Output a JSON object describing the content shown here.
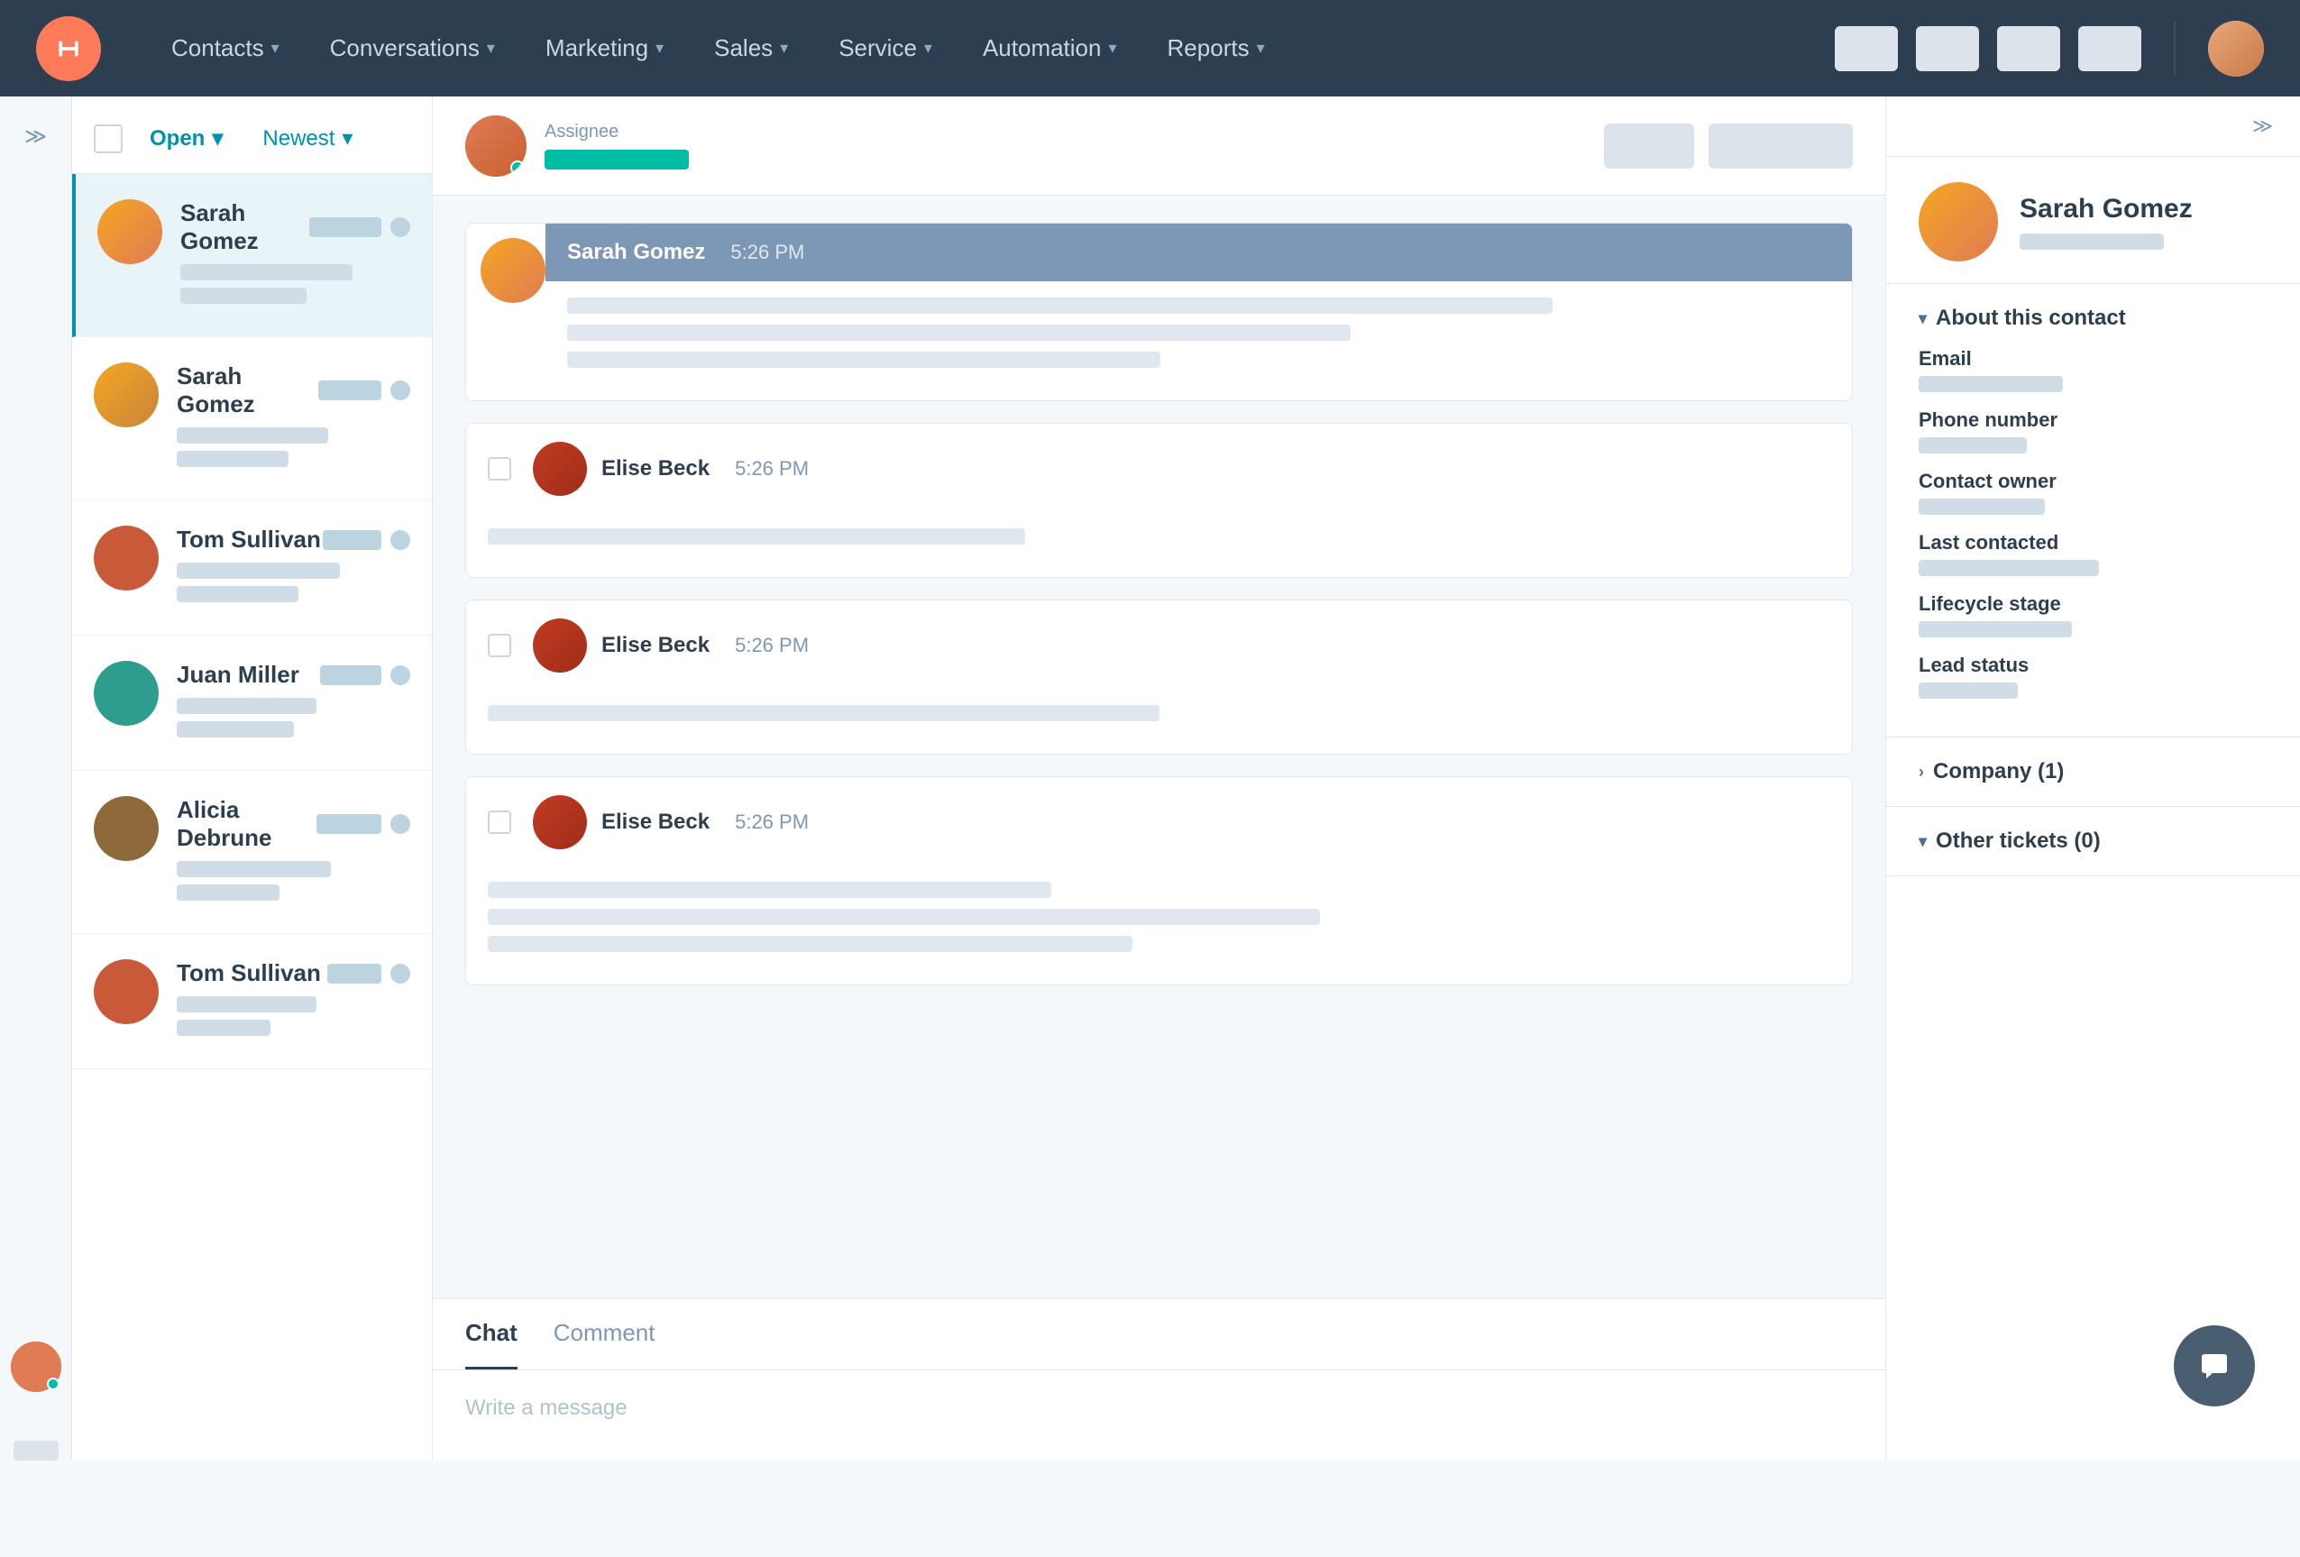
{
  "nav": {
    "items": [
      {
        "label": "Contacts",
        "id": "contacts"
      },
      {
        "label": "Conversations",
        "id": "conversations"
      },
      {
        "label": "Marketing",
        "id": "marketing"
      },
      {
        "label": "Sales",
        "id": "sales"
      },
      {
        "label": "Service",
        "id": "service"
      },
      {
        "label": "Automation",
        "id": "automation"
      },
      {
        "label": "Reports",
        "id": "reports"
      }
    ]
  },
  "conv_list": {
    "filter_label": "Open",
    "sort_label": "Newest",
    "conversations": [
      {
        "name": "Sarah Gomez",
        "avatar_class": "av-sarah-g",
        "active": true
      },
      {
        "name": "Sarah Gomez",
        "avatar_class": "av-sarah-g2",
        "active": false
      },
      {
        "name": "Tom Sullivan",
        "avatar_class": "av-tom",
        "active": false
      },
      {
        "name": "Juan Miller",
        "avatar_class": "av-juan",
        "active": false
      },
      {
        "name": "Alicia Debrune",
        "avatar_class": "av-alicia",
        "active": false
      },
      {
        "name": "Tom Sullivan",
        "avatar_class": "av-tom2",
        "active": false
      }
    ]
  },
  "chat": {
    "assignee_label": "Assignee",
    "messages": [
      {
        "sender": "Sarah Gomez",
        "time": "5:26 PM",
        "type": "outbound",
        "lines": [
          100,
          80,
          60
        ]
      },
      {
        "sender": "Elise Beck",
        "time": "5:26 PM",
        "type": "inbound",
        "lines": [
          55
        ]
      },
      {
        "sender": "Elise Beck",
        "time": "5:26 PM",
        "type": "inbound",
        "lines": [
          65
        ]
      },
      {
        "sender": "Elise Beck",
        "time": "5:26 PM",
        "type": "inbound",
        "lines": [
          55,
          80,
          60
        ]
      }
    ],
    "tabs": [
      "Chat",
      "Comment"
    ],
    "active_tab": "Chat",
    "input_placeholder": "Write a message"
  },
  "right_panel": {
    "contact_name": "Sarah Gomez",
    "sections": {
      "about_title": "About this contact",
      "fields": [
        {
          "label": "Email",
          "value_width": 160
        },
        {
          "label": "Phone number",
          "value_width": 120
        },
        {
          "label": "Contact owner",
          "value_width": 140
        },
        {
          "label": "Last contacted",
          "value_width": 200
        },
        {
          "label": "Lifecycle stage",
          "value_width": 170
        },
        {
          "label": "Lead status",
          "value_width": 110
        }
      ]
    },
    "company_label": "Company (1)",
    "other_tickets_label": "Other tickets (0)"
  }
}
